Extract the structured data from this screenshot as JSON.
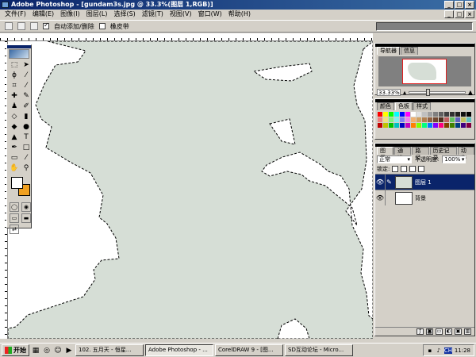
{
  "window": {
    "title": "Adobe Photoshop - [gundam3s.jpg @ 33.3%(图层 1,RGB)]",
    "minimize": "_",
    "maximize": "□",
    "close": "×"
  },
  "menu": [
    "文件(F)",
    "编辑(E)",
    "图像(I)",
    "图层(L)",
    "选择(S)",
    "滤镜(T)",
    "视图(V)",
    "窗口(W)",
    "帮助(H)"
  ],
  "options_bar": {
    "auto_add_delete_label": "自动添加/删除",
    "auto_add_delete_checked": true,
    "rubber_band_label": "橡皮带",
    "rubber_band_checked": false
  },
  "toolbox": {
    "foreground_color": "#ffffff",
    "background_color": "#f0a020",
    "tools": [
      "marquee-icon",
      "move-icon",
      "lasso-icon",
      "magic-wand-icon",
      "crop-icon",
      "slice-icon",
      "healing-icon",
      "brush-icon",
      "stamp-icon",
      "history-brush-icon",
      "eraser-icon",
      "gradient-icon",
      "blur-icon",
      "dodge-icon",
      "path-select-icon",
      "type-icon",
      "pen-icon",
      "shape-icon",
      "notes-icon",
      "eyedropper-icon",
      "hand-icon",
      "zoom-icon"
    ]
  },
  "canvas": {
    "image_color": "#d6ded6",
    "background_color": "#ffffff"
  },
  "navigator": {
    "tabs": [
      "导航器",
      "信息"
    ],
    "active_tab": 0,
    "zoom": "33.33%"
  },
  "color_palette": {
    "tabs": [
      "颜色",
      "色板",
      "样式"
    ],
    "active_tab": 1
  },
  "layers_palette": {
    "tabs": [
      "图层",
      "通道",
      "路径",
      "历史记录",
      "动作"
    ],
    "active_tab": 0,
    "blend_mode": "正常",
    "opacity_label": "不透明度:",
    "opacity_value": "100%",
    "lock_label": "锁定:",
    "layers": [
      {
        "name": "图层 1",
        "selected": true,
        "visible": true,
        "thumb_color": "#d6ded6"
      },
      {
        "name": "背景",
        "selected": false,
        "visible": true,
        "thumb_color": "#ffffff"
      }
    ]
  },
  "taskbar": {
    "start_label": "开始",
    "tasks": [
      {
        "label": "102. 五月天 - 恒星...",
        "active": false
      },
      {
        "label": "Adobe Photoshop - ...",
        "active": true
      },
      {
        "label": "CorelDRAW 9 - [图...",
        "active": false
      },
      {
        "label": "SD互动论坛 - Micro...",
        "active": false
      }
    ],
    "clock": "11:28",
    "ime": "CH"
  }
}
